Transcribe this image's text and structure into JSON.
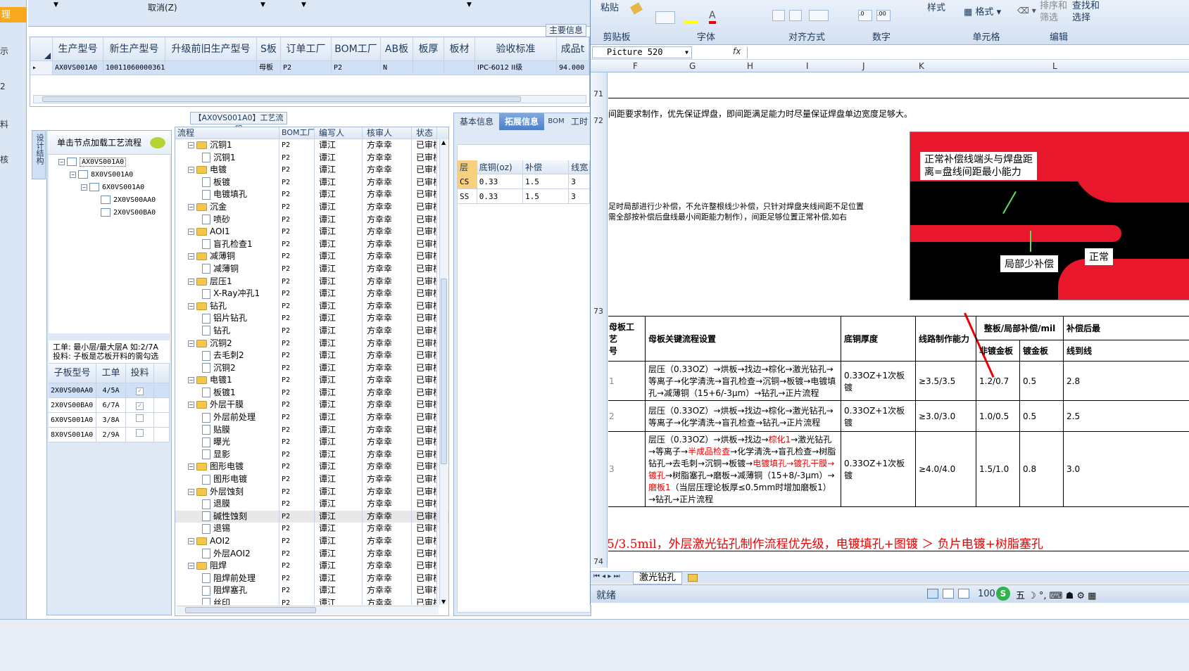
{
  "left_strip": {
    "items": [
      "理",
      "示",
      "2",
      "料",
      "核"
    ]
  },
  "top_toolbar": {
    "cancel_label": "取消(Z)"
  },
  "main_info_tab": "主要信息",
  "product_grid": {
    "columns": [
      "生产型号",
      "新生产型号",
      "升级前旧生产型号",
      "S板",
      "订单工厂",
      "BOM工厂",
      "AB板",
      "板厚",
      "板材",
      "验收标准",
      "成品t"
    ],
    "row": [
      "AX0VS001A0",
      "10011060000361",
      "",
      "母板",
      "P2",
      "P2",
      "N",
      "",
      "",
      "IPC-6012 II级",
      "94.000"
    ]
  },
  "process_title": "【AX0VS001A0】工艺流程",
  "side_vertical_tab": "设计结构",
  "struct_tree": {
    "hint": "单击节点加载工艺流程",
    "nodes": [
      "AX0VS001A0",
      "8X0VS001A0",
      "6X0VS001A0",
      "2X0VS00AA0",
      "2X0VS00BA0"
    ]
  },
  "work_note": {
    "line1": "工单: 最小层/最大层A 如:2/7A",
    "line2": "投料: 子板是芯板开料的需勾选"
  },
  "sub_grid": {
    "columns": [
      "子板型号",
      "工单",
      "投料"
    ],
    "rows": [
      {
        "model": "2X0VS00AA0",
        "order": "4/5A",
        "checked": true
      },
      {
        "model": "2X0VS00BA0",
        "order": "6/7A",
        "checked": true
      },
      {
        "model": "6X0VS001A0",
        "order": "3/8A",
        "checked": false
      },
      {
        "model": "8X0VS001A0",
        "order": "2/9A",
        "checked": false
      }
    ]
  },
  "flow_grid": {
    "columns": [
      "流程",
      "BOM工厂",
      "编写人",
      "核审人",
      "状态"
    ],
    "rows": [
      {
        "level": 0,
        "name": "沉铜1"
      },
      {
        "level": 1,
        "name": "沉铜1"
      },
      {
        "level": 0,
        "name": "电镀"
      },
      {
        "level": 1,
        "name": "板镀"
      },
      {
        "level": 1,
        "name": "电镀填孔"
      },
      {
        "level": 0,
        "name": "沉金"
      },
      {
        "level": 1,
        "name": "喷砂"
      },
      {
        "level": 0,
        "name": "AOI1"
      },
      {
        "level": 1,
        "name": "盲孔检查1"
      },
      {
        "level": 0,
        "name": "减薄铜"
      },
      {
        "level": 1,
        "name": "减薄铜"
      },
      {
        "level": 0,
        "name": "层压1"
      },
      {
        "level": 1,
        "name": "X-Ray冲孔1"
      },
      {
        "level": 0,
        "name": "钻孔"
      },
      {
        "level": 1,
        "name": "铝片钻孔"
      },
      {
        "level": 1,
        "name": "钻孔"
      },
      {
        "level": 0,
        "name": "沉铜2"
      },
      {
        "level": 1,
        "name": "去毛刺2"
      },
      {
        "level": 1,
        "name": "沉铜2"
      },
      {
        "level": 0,
        "name": "电镀1"
      },
      {
        "level": 1,
        "name": "板镀1"
      },
      {
        "level": 0,
        "name": "外层干膜"
      },
      {
        "level": 1,
        "name": "外层前处理"
      },
      {
        "level": 1,
        "name": "贴膜"
      },
      {
        "level": 1,
        "name": "曝光"
      },
      {
        "level": 1,
        "name": "显影"
      },
      {
        "level": 0,
        "name": "图形电镀"
      },
      {
        "level": 1,
        "name": "图形电镀"
      },
      {
        "level": 0,
        "name": "外层蚀刻"
      },
      {
        "level": 1,
        "name": "退膜"
      },
      {
        "level": 1,
        "name": "碱性蚀刻"
      },
      {
        "level": 1,
        "name": "退锡"
      },
      {
        "level": 0,
        "name": "AOI2"
      },
      {
        "level": 1,
        "name": "外层AOI2"
      },
      {
        "level": 0,
        "name": "阻焊"
      },
      {
        "level": 1,
        "name": "阻焊前处理"
      },
      {
        "level": 1,
        "name": "阻焊塞孔"
      },
      {
        "level": 1,
        "name": "丝印"
      }
    ],
    "bom": "P2",
    "writer": "谭江",
    "reviewer": "方幸幸",
    "status": "已审核"
  },
  "info_tabs": [
    "基本信息",
    "拓展信息",
    "BOM",
    "工时"
  ],
  "layer_grid": {
    "columns": [
      "层",
      "底铜(oz)",
      "补偿",
      "线宽"
    ],
    "rows": [
      [
        "CS",
        "0.33",
        "1.5",
        "3"
      ],
      [
        "SS",
        "0.33",
        "1.5",
        "3"
      ]
    ]
  },
  "excel": {
    "ribbon": {
      "paste": "粘贴",
      "clipboard": "剪贴板",
      "font": "字体",
      "align": "对齐方式",
      "number": "数字",
      "style": "样式",
      "format": "格式",
      "cells": "单元格",
      "sort": "排序和",
      "filter": "筛选",
      "find": "查找和",
      "select": "选择",
      "edit": "编辑"
    },
    "name_box": "Picture 520",
    "fx": "fx",
    "columns": [
      "F",
      "G",
      "H",
      "I",
      "J",
      "K",
      "L"
    ],
    "rows": [
      "71",
      "72",
      "73",
      "74"
    ],
    "text_line1": "间距要求制作，优先保证焊盘，即间距满足能力时尽量保证焊盘单边宽度足够大。",
    "text_line2": "足时局部进行少补偿，不允许整根线少补偿，只针对焊盘夹线间距不足位置",
    "text_line3": "需全部按补偿后盘线最小间距能力制作），间距足够位置正常补偿,如右",
    "picture": {
      "label1": "正常补偿线端头与焊盘距",
      "label2": "离=盘线间距最小能力",
      "label3": "局部少补偿",
      "label4": "正常"
    },
    "table": {
      "headers": [
        "母板工艺",
        "号",
        "母板关键流程设置",
        "底铜厚度",
        "线路制作能力",
        "整板/局部补偿/mil",
        "补偿后最",
        "非镀金板",
        "镀金板",
        "线到线"
      ],
      "rows": [
        {
          "id": "1",
          "flow": "层压（0.33OZ）→烘板→找边→棕化→激光钻孔→等离子→化学清洗→盲孔检查→沉铜→板镀→电镀填孔→减薄铜（15+6/-3μm）→钻孔→正片流程",
          "cu": "0.33OZ+1次板镀",
          "cap": "≥3.5/3.5",
          "a": "1.2/0.7",
          "b": "0.5",
          "c": "2.8"
        },
        {
          "id": "2",
          "flow": "层压（0.33OZ）→烘板→找边→棕化→激光钻孔→等离子→化学清洗→盲孔检查→钻孔→正片流程",
          "cu": "0.33OZ+1次板镀",
          "cap": "≥3.0/3.0",
          "a": "1.0/0.5",
          "b": "0.5",
          "c": "2.5"
        },
        {
          "id": "3",
          "flow_a": "层压（0.33OZ）→烘板→找边→",
          "flow_b": "棕化1",
          "flow_c": "→激光钻孔→等离子→",
          "flow_d": "半成品检查",
          "flow_e": "→化学清洗→盲孔检查→树脂钻孔→去毛刺→沉铜→板镀→",
          "flow_f": "电镀填孔→镀孔干膜→镀孔",
          "flow_g": "→树脂塞孔→磨板→减薄铜（15+8/-3μm）→",
          "flow_h": "磨板1",
          "flow_i": "（当层压理论板厚≤0.5mm时增加磨板1）→钻孔→正片流程",
          "cu": "0.33OZ+1次板镀",
          "cap": "≥4.0/4.0",
          "a": "1.5/1.0",
          "b": "0.8",
          "c": "3.0"
        }
      ]
    },
    "red_note": "5/3.5mil，外层激光钻孔制作流程优先级，电镀填孔+图镀 ＞ 负片电镀+树脂塞孔",
    "sheet_tab": "激光钻孔",
    "status": "就绪",
    "zoom": "100"
  }
}
